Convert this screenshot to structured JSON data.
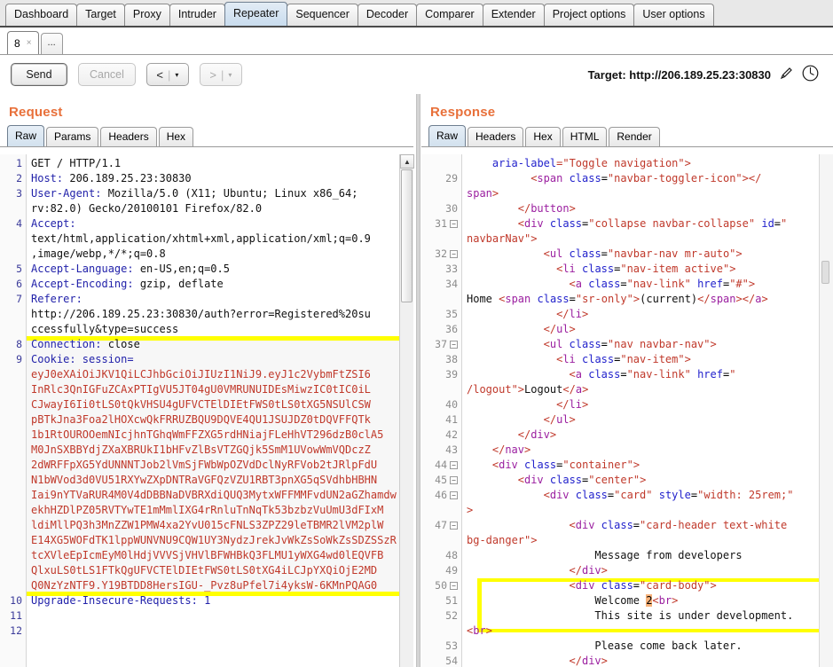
{
  "window": {
    "main_tabs": [
      {
        "label": "Dashboard",
        "selected": false
      },
      {
        "label": "Target",
        "selected": false
      },
      {
        "label": "Proxy",
        "selected": false
      },
      {
        "label": "Intruder",
        "selected": false
      },
      {
        "label": "Repeater",
        "selected": true
      },
      {
        "label": "Sequencer",
        "selected": false
      },
      {
        "label": "Decoder",
        "selected": false
      },
      {
        "label": "Comparer",
        "selected": false
      },
      {
        "label": "Extender",
        "selected": false
      },
      {
        "label": "Project options",
        "selected": false
      },
      {
        "label": "User options",
        "selected": false
      }
    ],
    "repeater_tabs": [
      {
        "label": "8",
        "close": "×",
        "selected": true
      },
      {
        "label": "...",
        "selected": false
      }
    ]
  },
  "toolbar": {
    "send_label": "Send",
    "cancel_label": "Cancel",
    "back_label": "<",
    "forward_label": ">",
    "caret": "▾",
    "separator": "|",
    "target_label": "Target: http://206.189.25.23:30830",
    "edit_icon": "pencil-icon",
    "help_icon": "help-circle-icon"
  },
  "request": {
    "title": "Request",
    "tabs": [
      {
        "label": "Raw",
        "selected": true
      },
      {
        "label": "Params",
        "selected": false
      },
      {
        "label": "Headers",
        "selected": false
      },
      {
        "label": "Hex",
        "selected": false
      }
    ],
    "gutter": [
      "1",
      "2",
      "3",
      "",
      "4",
      "",
      "",
      "5",
      "6",
      "7",
      "",
      "",
      "8",
      "9",
      "",
      "",
      "",
      "",
      "",
      "",
      "",
      "",
      "",
      "",
      "",
      "",
      "",
      "",
      "",
      "10",
      "11",
      "12"
    ],
    "lines": [
      {
        "name": "GET / HTTP/1.1",
        "type": "plain"
      },
      {
        "name": "Host: ",
        "value": "206.189.25.23:30830",
        "type": "header"
      },
      {
        "name": "User-Agent: ",
        "value": "Mozilla/5.0 (X11; Ubuntu; Linux x86_64;",
        "type": "header"
      },
      {
        "value": "rv:82.0) Gecko/20100101 Firefox/82.0",
        "type": "cont"
      },
      {
        "name": "Accept:",
        "type": "header"
      },
      {
        "value": "text/html,application/xhtml+xml,application/xml;q=0.9",
        "type": "cont"
      },
      {
        "value": ",image/webp,*/*;q=0.8",
        "type": "cont"
      },
      {
        "name": "Accept-Language: ",
        "value": "en-US,en;q=0.5",
        "type": "header"
      },
      {
        "name": "Accept-Encoding: ",
        "value": "gzip, deflate",
        "type": "header"
      },
      {
        "name": "Referer:",
        "type": "header"
      },
      {
        "value": "http://206.189.25.23:30830/auth?error=Registered%20su",
        "type": "cont"
      },
      {
        "value": "ccessfully&type=success",
        "type": "cont"
      },
      {
        "name": "Connection: ",
        "value": "close",
        "type": "header"
      }
    ],
    "cookie_header": "Cookie: session=",
    "cookie_value_lines": [
      "eyJ0eXAiOiJKV1QiLCJhbGciOiJIUzI1NiJ9.eyJ1c2VybmFtZSI6",
      "InRlc3QnIGFuZCAxPTIgVU5JT04gU0VMRUNUIDEsMiwzIC0tIC0iL",
      "CJwayI6Ii0tLS0tQkVHSU4gUFVCTElDIEtFWS0tLS0tXG5NSUlCSW",
      "pBTkJna3Foa2lHOXcwQkFRRUZBQU9DQVE4QU1JSUJDZ0tDQVFFQTk",
      "1b1RtOUROOemNIcjhnTGhqWmFFZXG5rdHNiajFLeHhVT296dzB0clA5",
      "M0JnSXBBYdjZXaXBRUkI1bHFvZlBsVTZGQjk5SmM1UVowWmVQDczZ",
      "2dWRFFpXG5YdUNNNTJob2lVmSjFWbWpOZVdDclNyRFVob2tJRlpFdU",
      "N1bWVod3d0VU51RXYwZXpDNTRaVGFQzVZU1RBT3pnXG5qSVdhbHBHN",
      "Iai9nYTVaRUR4M0V4dDBBNaDVBRXdiQUQ3MytxWFFMMFvdUN2aGZhamdw",
      "ekhHZDlPZ05RVTYwTE1mMmlIXG4rRnluTnNqTk53bzbzVuUmU3dFIxM",
      "ldiMllPQ3h3MnZZW1PMW4xa2YvU015cFNLS3ZPZ29leTBMR2lVM2plW",
      "E14XG5WOFdTK1lppWUNVNU9CQW1UY3NydzJrekJvWkZsSoWkZsSDZSSzR",
      "tcXVleEpIcmEyM0lHdjVVVSjVHVlBFWHBkQ3FLMU1yWXG4wd0lEQVFB",
      "QlxuLS0tLS1FTkQgUFVCTElDIEtFWS0tLS0tXG4iLCJpYXQiOjE2MD",
      "Q0NzYzNTF9.Y19BTDD8HersIGU-_Pvz8uPfel7i4yksW-6KMnPQAG0"
    ],
    "tail_line": "Upgrade-Insecure-Requests: 1",
    "scrollbar_up": "▲"
  },
  "response": {
    "title": "Response",
    "tabs": [
      {
        "label": "Raw",
        "selected": true
      },
      {
        "label": "Headers",
        "selected": false
      },
      {
        "label": "Hex",
        "selected": false
      },
      {
        "label": "HTML",
        "selected": false
      },
      {
        "label": "Render",
        "selected": false
      }
    ],
    "code_lines": [
      {
        "num": "",
        "fold": false,
        "html": "<span class='attr'>aria-label</span><span class='attrval'>=\"Toggle navigation\"</span><span class='tag'>&gt;</span>",
        "indent": 4
      },
      {
        "num": "29",
        "fold": false,
        "html": "<span class='tag'>&lt;</span><span class='tagname'>span</span> <span class='attr'>class</span>=<span class='attrval'>\"navbar-toggler-icon\"</span><span class='tag'>&gt;&lt;/</span>",
        "indent": 10
      },
      {
        "num": "",
        "fold": false,
        "html": "<span class='tagname'>span</span><span class='tag'>&gt;</span>",
        "indent": 0
      },
      {
        "num": "30",
        "fold": false,
        "html": "<span class='tag'>&lt;/</span><span class='tagname'>button</span><span class='tag'>&gt;</span>",
        "indent": 8
      },
      {
        "num": "31",
        "fold": true,
        "html": "<span class='tag'>&lt;</span><span class='tagname'>div</span> <span class='attr'>class</span>=<span class='attrval'>\"collapse navbar-collapse\"</span> <span class='attr'>id</span>=<span class='attrval'>\"</span>",
        "indent": 8
      },
      {
        "num": "",
        "fold": false,
        "html": "<span class='attrval'>navbarNav\"</span><span class='tag'>&gt;</span>",
        "indent": 0
      },
      {
        "num": "32",
        "fold": true,
        "html": "<span class='tag'>&lt;</span><span class='tagname'>ul</span> <span class='attr'>class</span>=<span class='attrval'>\"navbar-nav mr-auto\"</span><span class='tag'>&gt;</span>",
        "indent": 12
      },
      {
        "num": "33",
        "fold": false,
        "html": "<span class='tag'>&lt;</span><span class='tagname'>li</span> <span class='attr'>class</span>=<span class='attrval'>\"nav-item active\"</span><span class='tag'>&gt;</span>",
        "indent": 14
      },
      {
        "num": "34",
        "fold": false,
        "html": "<span class='tag'>&lt;</span><span class='tagname'>a</span> <span class='attr'>class</span>=<span class='attrval'>\"nav-link\"</span> <span class='attr'>href</span>=<span class='attrval'>\"#\"</span><span class='tag'>&gt;</span>",
        "indent": 16
      },
      {
        "num": "",
        "fold": false,
        "html": "<span class='txt'>Home </span><span class='tag'>&lt;</span><span class='tagname'>span</span> <span class='attr'>class</span>=<span class='attrval'>\"sr-only\"</span><span class='tag'>&gt;</span><span class='txt'>(current)</span><span class='tag'>&lt;/</span><span class='tagname'>span</span><span class='tag'>&gt;&lt;/</span><span class='tagname'>a</span><span class='tag'>&gt;</span>",
        "indent": 0
      },
      {
        "num": "35",
        "fold": false,
        "html": "<span class='tag'>&lt;/</span><span class='tagname'>li</span><span class='tag'>&gt;</span>",
        "indent": 14
      },
      {
        "num": "36",
        "fold": false,
        "html": "<span class='tag'>&lt;/</span><span class='tagname'>ul</span><span class='tag'>&gt;</span>",
        "indent": 12
      },
      {
        "num": "37",
        "fold": true,
        "html": "<span class='tag'>&lt;</span><span class='tagname'>ul</span> <span class='attr'>class</span>=<span class='attrval'>\"nav navbar-nav\"</span><span class='tag'>&gt;</span>",
        "indent": 12
      },
      {
        "num": "38",
        "fold": false,
        "html": "<span class='tag'>&lt;</span><span class='tagname'>li</span> <span class='attr'>class</span>=<span class='attrval'>\"nav-item\"</span><span class='tag'>&gt;</span>",
        "indent": 14
      },
      {
        "num": "39",
        "fold": false,
        "html": "<span class='tag'>&lt;</span><span class='tagname'>a</span> <span class='attr'>class</span>=<span class='attrval'>\"nav-link\"</span> <span class='attr'>href</span>=<span class='attrval'>\"</span>",
        "indent": 16
      },
      {
        "num": "",
        "fold": false,
        "html": "<span class='attrval'>/logout\"</span><span class='tag'>&gt;</span><span class='txt'>Logout</span><span class='tag'>&lt;/</span><span class='tagname'>a</span><span class='tag'>&gt;</span>",
        "indent": 0
      },
      {
        "num": "40",
        "fold": false,
        "html": "<span class='tag'>&lt;/</span><span class='tagname'>li</span><span class='tag'>&gt;</span>",
        "indent": 14
      },
      {
        "num": "41",
        "fold": false,
        "html": "<span class='tag'>&lt;/</span><span class='tagname'>ul</span><span class='tag'>&gt;</span>",
        "indent": 12
      },
      {
        "num": "42",
        "fold": false,
        "html": "<span class='tag'>&lt;/</span><span class='tagname'>div</span><span class='tag'>&gt;</span>",
        "indent": 8
      },
      {
        "num": "43",
        "fold": false,
        "html": "<span class='tag'>&lt;/</span><span class='tagname'>nav</span><span class='tag'>&gt;</span>",
        "indent": 4
      },
      {
        "num": "44",
        "fold": true,
        "html": "<span class='tag'>&lt;</span><span class='tagname'>div</span> <span class='attr'>class</span>=<span class='attrval'>\"container\"</span><span class='tag'>&gt;</span>",
        "indent": 4
      },
      {
        "num": "45",
        "fold": true,
        "html": "<span class='tag'>&lt;</span><span class='tagname'>div</span> <span class='attr'>class</span>=<span class='attrval'>\"center\"</span><span class='tag'>&gt;</span>",
        "indent": 8
      },
      {
        "num": "46",
        "fold": true,
        "html": "<span class='tag'>&lt;</span><span class='tagname'>div</span> <span class='attr'>class</span>=<span class='attrval'>\"card\"</span> <span class='attr'>style</span>=<span class='attrval'>\"width: 25rem;\"</span>",
        "indent": 12
      },
      {
        "num": "",
        "fold": false,
        "html": "<span class='tag'>&gt;</span>",
        "indent": 0
      },
      {
        "num": "47",
        "fold": true,
        "html": "<span class='tag'>&lt;</span><span class='tagname'>div</span> <span class='attr'>class</span>=<span class='attrval'>\"card-header text-white</span>",
        "indent": 16
      },
      {
        "num": "",
        "fold": false,
        "html": "<span class='attrval'>bg-danger\"</span><span class='tag'>&gt;</span>",
        "indent": 0
      },
      {
        "num": "48",
        "fold": false,
        "html": "<span class='txt'>Message from developers</span>",
        "indent": 20
      },
      {
        "num": "49",
        "fold": false,
        "html": "<span class='tag'>&lt;/</span><span class='tagname'>div</span><span class='tag'>&gt;</span>",
        "indent": 16
      },
      {
        "num": "50",
        "fold": true,
        "html": "<span class='tag'>&lt;</span><span class='tagname'>div</span> <span class='attr'>class</span>=<span class='attrval'>\"card-body\"</span><span class='tag'>&gt;</span>",
        "indent": 16
      },
      {
        "num": "51",
        "fold": false,
        "html": "<span class='txt'>Welcome </span><span class='hl-mark'>2</span><span class='tag'>&lt;</span><span class='tagname'>br</span><span class='tag'>&gt;</span>",
        "indent": 20
      },
      {
        "num": "52",
        "fold": false,
        "html": "<span class='txt'>This site is under development.</span>",
        "indent": 20
      },
      {
        "num": "",
        "fold": false,
        "html": "<span class='tag'>&lt;</span><span class='tagname'>br</span><span class='tag'>&gt;</span>",
        "indent": 0
      },
      {
        "num": "53",
        "fold": false,
        "html": "<span class='txt'>Please come back later.</span>",
        "indent": 20
      },
      {
        "num": "54",
        "fold": false,
        "html": "<span class='tag'>&lt;/</span><span class='tagname'>div</span><span class='tag'>&gt;</span>",
        "indent": 16
      }
    ]
  },
  "colors": {
    "accent": "#e8703a",
    "highlight": "#ffff00",
    "cookie_text": "#c0392b",
    "header_name": "#2222aa",
    "tag": "#c0392b",
    "tagname": "#9b1fa0",
    "attr": "#2222cc",
    "selected_tab": "#c9dcee"
  }
}
